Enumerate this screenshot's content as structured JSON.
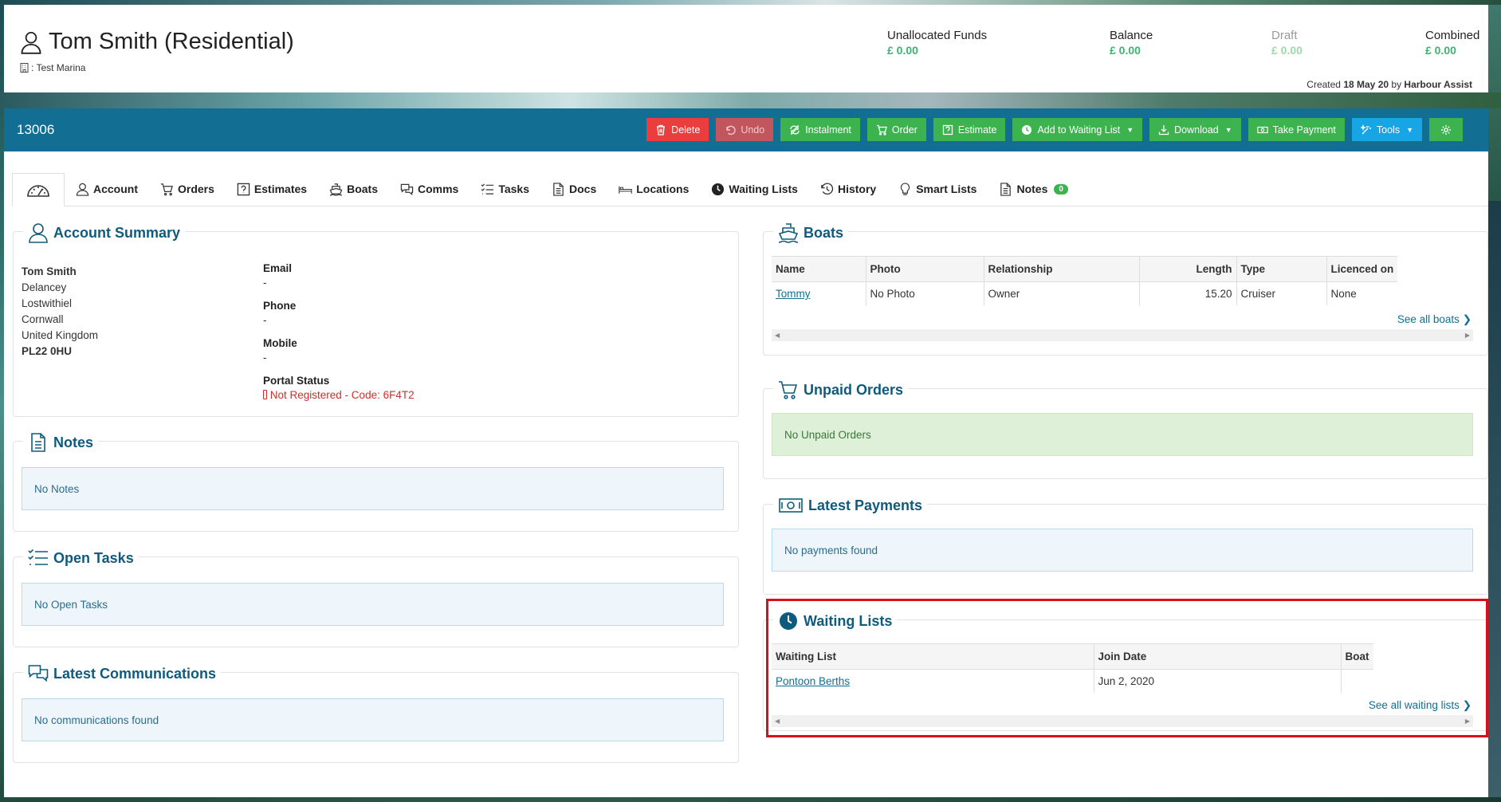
{
  "header": {
    "customer_name": "Tom Smith (Residential)",
    "marina": ": Test Marina",
    "finance": [
      {
        "label": "Unallocated Funds",
        "value": "£ 0.00"
      },
      {
        "label": "Balance",
        "value": "£ 0.00"
      },
      {
        "label": "Draft",
        "value": "£ 0.00"
      },
      {
        "label": "Combined",
        "value": "£ 0.00"
      }
    ],
    "created_prefix": "Created",
    "created_date": "18 May 20",
    "created_by_prefix": "by",
    "created_by": "Harbour Assist"
  },
  "toolbar": {
    "account_number": "13006",
    "delete": "Delete",
    "undo": "Undo",
    "instalment": "Instalment",
    "order": "Order",
    "estimate": "Estimate",
    "add_waiting": "Add to Waiting List",
    "download": "Download",
    "take_payment": "Take Payment",
    "tools": "Tools"
  },
  "tabs": {
    "account": "Account",
    "orders": "Orders",
    "estimates": "Estimates",
    "boats": "Boats",
    "comms": "Comms",
    "tasks": "Tasks",
    "docs": "Docs",
    "locations": "Locations",
    "waiting_lists": "Waiting Lists",
    "history": "History",
    "smart_lists": "Smart Lists",
    "notes": "Notes",
    "notes_count": "0"
  },
  "account_summary": {
    "title": "Account Summary",
    "name": "Tom Smith",
    "address": [
      "Delancey",
      "Lostwithiel",
      "Cornwall",
      "United Kingdom"
    ],
    "postcode": "PL22 0HU",
    "email_label": "Email",
    "email": "-",
    "phone_label": "Phone",
    "phone": "-",
    "mobile_label": "Mobile",
    "mobile": "-",
    "portal_label": "Portal Status",
    "portal_status": "Not Registered - Code: 6F4T2"
  },
  "notes": {
    "title": "Notes",
    "empty": "No Notes"
  },
  "open_tasks": {
    "title": "Open Tasks",
    "empty": "No Open Tasks"
  },
  "latest_comms": {
    "title": "Latest Communications",
    "empty": "No communications found"
  },
  "boats": {
    "title": "Boats",
    "columns": [
      "Name",
      "Photo",
      "Relationship",
      "Length",
      "Type",
      "Licenced on"
    ],
    "rows": [
      {
        "name": "Tommy",
        "photo": "No Photo",
        "relationship": "Owner",
        "length": "15.20",
        "type": "Cruiser",
        "licenced_on": "None"
      }
    ],
    "see_all": "See all boats"
  },
  "unpaid_orders": {
    "title": "Unpaid Orders",
    "empty": "No Unpaid Orders"
  },
  "latest_payments": {
    "title": "Latest Payments",
    "empty": "No payments found"
  },
  "waiting_lists": {
    "title": "Waiting Lists",
    "columns": [
      "Waiting List",
      "Join Date",
      "Boat"
    ],
    "rows": [
      {
        "list": "Pontoon Berths",
        "join_date": "Jun 2, 2020",
        "boat": ""
      }
    ],
    "see_all": "See all waiting lists"
  },
  "colors": {
    "toolbar": "#126e93",
    "accent_green": "#3cb34f",
    "delete_red": "#ea3e3e",
    "tools_blue": "#17a5e6",
    "panel_title": "#0e5b7d"
  }
}
